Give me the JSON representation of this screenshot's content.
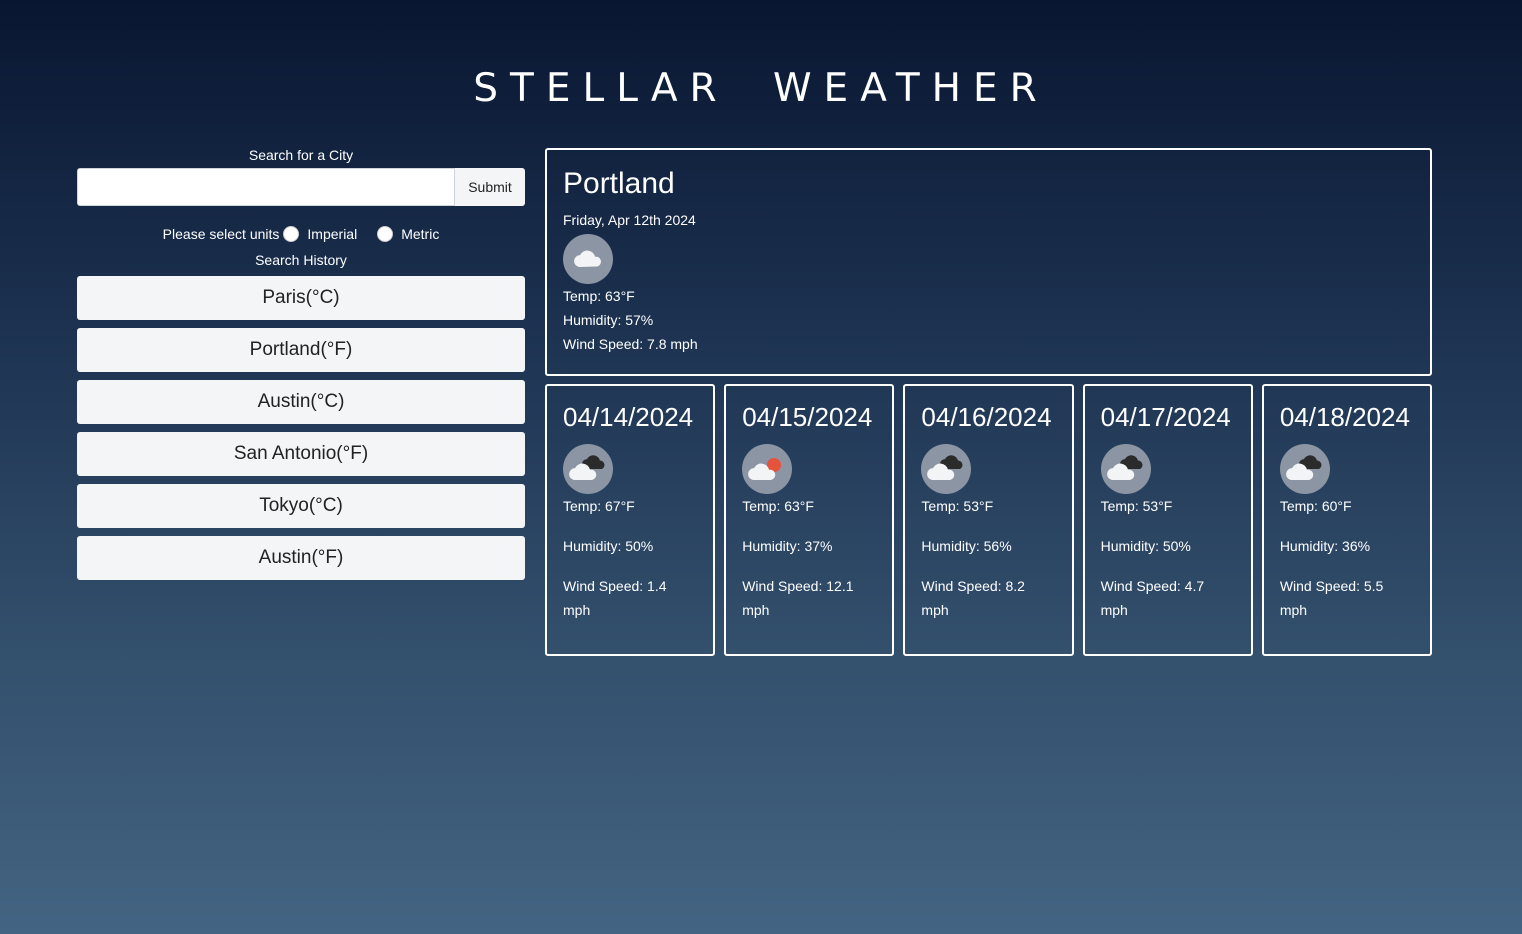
{
  "header": {
    "title": "STELLAR WEATHER"
  },
  "search": {
    "label": "Search for a City",
    "input_value": "",
    "placeholder": "",
    "submit_label": "Submit",
    "units_prompt": "Please select units",
    "unit_options": [
      "Imperial",
      "Metric"
    ],
    "history_label": "Search History",
    "history": [
      "Paris(°C)",
      "Portland(°F)",
      "Austin(°C)",
      "San Antonio(°F)",
      "Tokyo(°C)",
      "Austin(°F)"
    ]
  },
  "current": {
    "city": "Portland",
    "date": "Friday, Apr 12th 2024",
    "icon": "cloud-icon",
    "temp": "Temp: 63°F",
    "humidity": "Humidity: 57%",
    "wind": "Wind Speed: 7.8 mph"
  },
  "forecast": [
    {
      "date": "04/14/2024",
      "icon": "dark-clouds-icon",
      "temp": "Temp: 67°F",
      "humidity": "Humidity: 50%",
      "wind": "Wind Speed: 1.4 mph"
    },
    {
      "date": "04/15/2024",
      "icon": "cloud-sun-icon",
      "temp": "Temp: 63°F",
      "humidity": "Humidity: 37%",
      "wind": "Wind Speed: 12.1 mph"
    },
    {
      "date": "04/16/2024",
      "icon": "dark-clouds-icon",
      "temp": "Temp: 53°F",
      "humidity": "Humidity: 56%",
      "wind": "Wind Speed: 8.2 mph"
    },
    {
      "date": "04/17/2024",
      "icon": "dark-clouds-icon",
      "temp": "Temp: 53°F",
      "humidity": "Humidity: 50%",
      "wind": "Wind Speed: 4.7 mph"
    },
    {
      "date": "04/18/2024",
      "icon": "dark-clouds-icon",
      "temp": "Temp: 60°F",
      "humidity": "Humidity: 36%",
      "wind": "Wind Speed: 5.5 mph"
    }
  ],
  "colors": {
    "background_top": "#091631",
    "background_bottom": "#436482",
    "sun_accent": "#e5533d"
  }
}
